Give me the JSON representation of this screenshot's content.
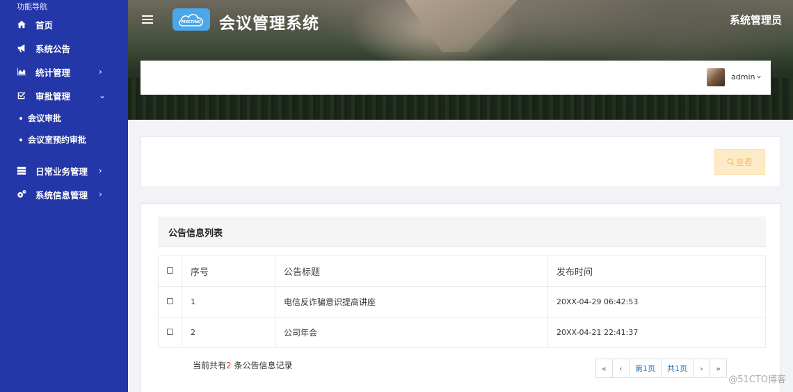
{
  "sidebar": {
    "title": "功能导航",
    "items": [
      {
        "label": "首页",
        "icon": "home-icon",
        "chevron": ""
      },
      {
        "label": "系统公告",
        "icon": "megaphone-icon",
        "chevron": ""
      },
      {
        "label": "统计管理",
        "icon": "area-chart-icon",
        "chevron": "›"
      },
      {
        "label": "审批管理",
        "icon": "checkbox-icon",
        "chevron": "⌄"
      }
    ],
    "subitems": [
      "会议审批",
      "会议室预约审批"
    ],
    "items2": [
      {
        "label": "日常业务管理",
        "icon": "server-icon",
        "chevron": "›"
      },
      {
        "label": "系统信息管理",
        "icon": "gears-icon",
        "chevron": "›"
      }
    ]
  },
  "header": {
    "logo_text": "MEETING",
    "title": "会议管理系统",
    "role": "系统管理员",
    "user": "admin"
  },
  "search": {
    "view_label": "查看"
  },
  "list": {
    "title": "公告信息列表",
    "columns": [
      "序号",
      "公告标题",
      "发布时间"
    ],
    "rows": [
      {
        "num": "1",
        "title": "电信反诈骗意识提高讲座",
        "time": "20XX-04-29 06:42:53"
      },
      {
        "num": "2",
        "title": "公司年会",
        "time": "20XX-04-21 22:41:37"
      }
    ],
    "summary_prefix": "当前共有",
    "summary_count": "2",
    "summary_suffix": " 条公告信息记录"
  },
  "pager": {
    "first": "«",
    "prev": "‹",
    "current": "第1页",
    "total": "共1页",
    "next": "›",
    "last": "»"
  },
  "watermark": "@51CTO博客",
  "colors": {
    "sidebar_bg": "#2437a8",
    "view_button_bg": "#fdebc8",
    "count_red": "#e03c2c",
    "link_blue": "#337ab7"
  }
}
